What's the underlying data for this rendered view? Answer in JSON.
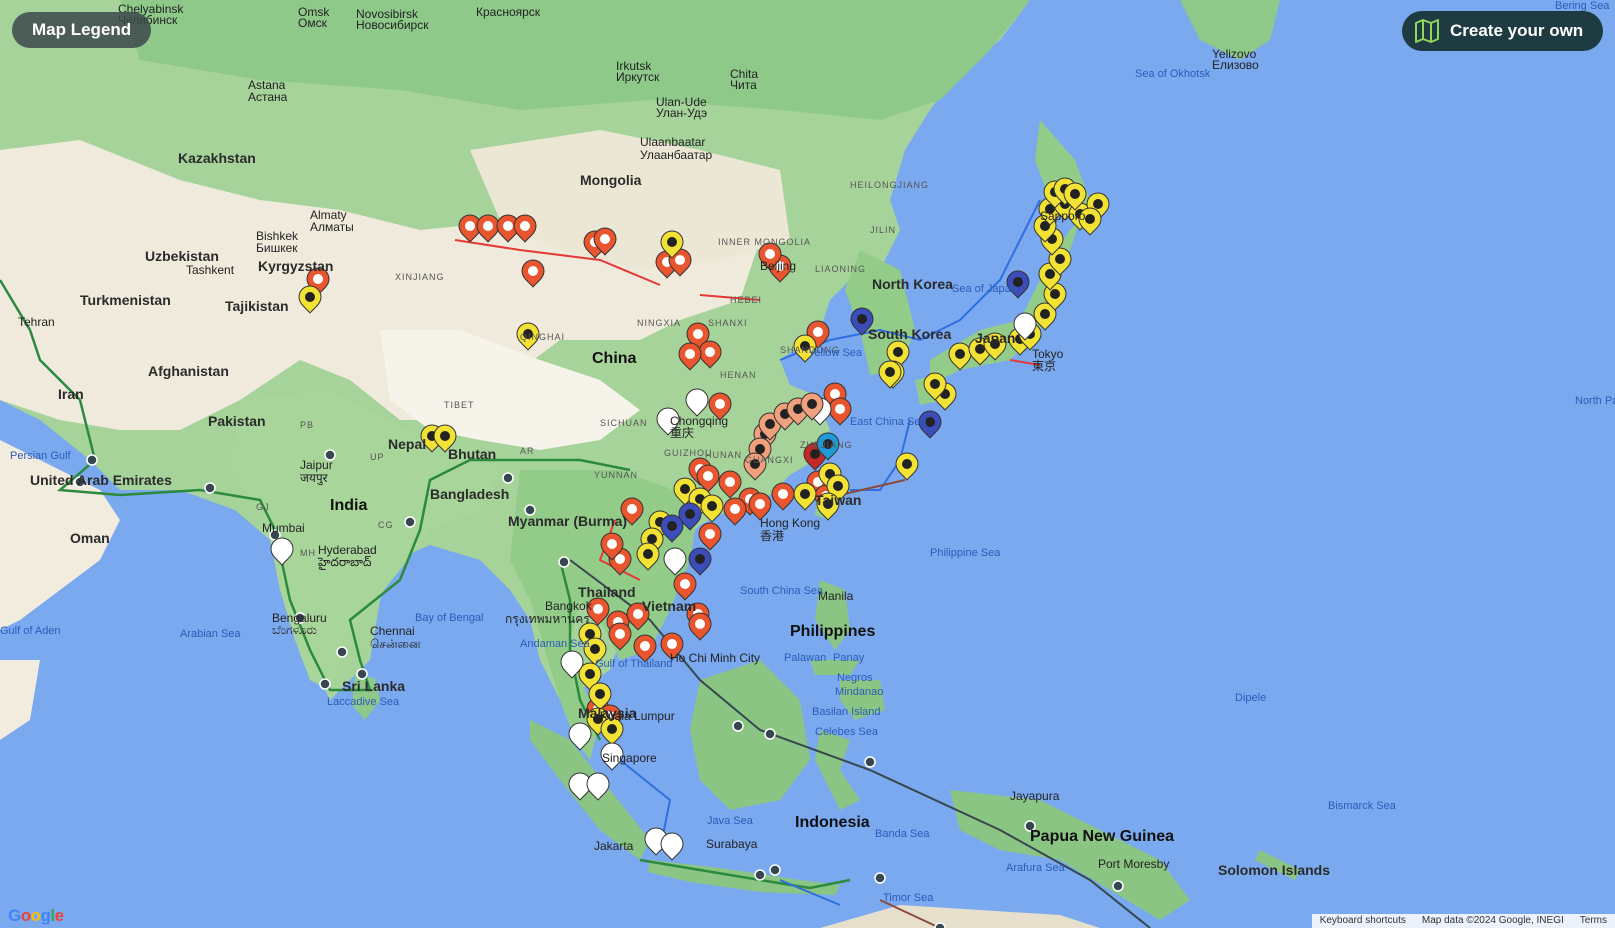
{
  "controls": {
    "legend_label": "Map Legend",
    "create_label": "Create your own"
  },
  "attribution": {
    "shortcuts": "Keyboard shortcuts",
    "data": "Map data ©2024 Google, INEGI",
    "terms": "Terms"
  },
  "logo": "Google",
  "colors": {
    "water": "#7aa9ef",
    "land": "#a8d59a",
    "desert": "#f3efe4",
    "red_pin": "#e8552f",
    "yellow_pin": "#f2e233",
    "route_green": "#2b8a3e",
    "route_blue": "#2f6fe0",
    "route_dark": "#37474f",
    "route_red": "#e53935"
  },
  "labels": {
    "countries": [
      "Kazakhstan",
      "Mongolia",
      "China",
      "Uzbekistan",
      "Kyrgyzstan",
      "Turkmenistan",
      "Tajikistan",
      "Afghanistan",
      "Iran",
      "Pakistan",
      "India",
      "Nepal",
      "Bhutan",
      "Bangladesh",
      "Myanmar (Burma)",
      "Thailand",
      "Vietnam",
      "Malaysia",
      "Indonesia",
      "Philippines",
      "North Korea",
      "South Korea",
      "Japan",
      "Papua New Guinea",
      "Solomon Islands",
      "Sri Lanka",
      "Oman",
      "United Arab Emirates",
      "Taiwan"
    ],
    "cities": [
      "Chelyabinsk",
      "Челябинск",
      "Omsk",
      "Омск",
      "Novosibirsk",
      "Новосибирск",
      "Красноярск",
      "Irkutsk",
      "Иркутск",
      "Chita",
      "Чита",
      "Ulan-Ude",
      "Улан-Удэ",
      "Ulaanbaatar",
      "Улаанбаатар",
      "Astana",
      "Астана",
      "Almaty",
      "Алматы",
      "Bishkek",
      "Бишкек",
      "Tashkent",
      "Tehran",
      "Jaipur",
      "जयपुर",
      "Hyderabad",
      "హైదరాబాద్",
      "Bengaluru",
      "ಬೆಂಗಳೂರು",
      "Chennai",
      "சென்னை",
      "Mumbai",
      "Chongqing",
      "重庆",
      "Hong Kong",
      "香港",
      "Bangkok",
      "กรุงเทพมหานคร",
      "Ho Chi Minh City",
      "Singapore",
      "Kuala Lumpur",
      "Manila",
      "Surabaya",
      "Jakarta",
      "Tokyo",
      "東京",
      "Port Moresby",
      "Yelizovo",
      "Елизово",
      "Beijing",
      "Sapporo",
      "Jayapura"
    ],
    "regions": [
      "XINJIANG",
      "TIBET",
      "QINGHAI",
      "INNER MONGOLIA",
      "HEILONGJIANG",
      "JILIN",
      "LIAONING",
      "NINGXIA",
      "SHANXI",
      "HENAN",
      "SICHUAN",
      "GUIZHOU",
      "YUNNAN",
      "HUNAN",
      "GUANGXI",
      "ZHEJIANG",
      "SHANDONG",
      "HEBEI",
      "GJ",
      "MH",
      "CG",
      "UP",
      "PB",
      "AR"
    ],
    "seas": [
      "Sea of Okhotsk",
      "Sea of Japan",
      "Yellow Sea",
      "East China Sea",
      "Philippine Sea",
      "South China Sea",
      "Celebes Sea",
      "Java Sea",
      "Banda Sea",
      "Arafura Sea",
      "Timor Sea",
      "Bismarck Sea",
      "Bay of Bengal",
      "Arabian Sea",
      "Laccadive Sea",
      "Andaman Sea",
      "Gulf of Thailand",
      "Persian Gulf",
      "Gulf of Aden",
      "North Pacific Ocean",
      "Bering Sea",
      "Palawan",
      "Negros",
      "Mindanao",
      "Basilan Island",
      "Panay",
      "Dipele"
    ]
  }
}
